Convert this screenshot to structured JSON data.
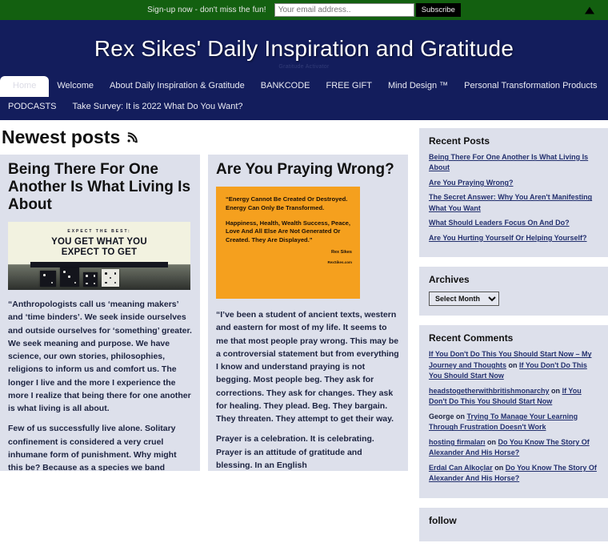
{
  "topbar": {
    "signup_text": "Sign-up now - don't miss the fun!",
    "email_placeholder": "Your email address..",
    "subscribe_label": "Subscribe",
    "scroll_top_icon": "triangle-up-icon",
    "bg_color": "#136010"
  },
  "header": {
    "title": "Rex Sikes' Daily Inspiration and Gratitude",
    "tagline": "Gratitude Activator",
    "bg_color": "#131d5c"
  },
  "nav": {
    "items": [
      {
        "label": "Home",
        "active": true
      },
      {
        "label": "Welcome",
        "active": false
      },
      {
        "label": "About Daily Inspiration & Gratitude",
        "active": false
      },
      {
        "label": "BANKCODE",
        "active": false
      },
      {
        "label": "FREE GIFT",
        "active": false
      },
      {
        "label": "Mind Design ™",
        "active": false
      },
      {
        "label": "Personal Transformation Products",
        "active": false
      }
    ],
    "items_row2": [
      {
        "label": "PODCASTS",
        "active": false
      },
      {
        "label": "Take Survey: It is 2022 What Do You Want?",
        "active": false
      }
    ]
  },
  "main": {
    "section_heading": "Newest posts",
    "rss_icon": "rss-feed-icon",
    "posts": [
      {
        "title": "Being There For One Another Is What Living Is About",
        "featured_image": {
          "type": "expect-the-best-dice-banner",
          "kicker": "EXPECT THE BEST:",
          "headline_line1": "YOU GET WHAT YOU",
          "headline_line2": "EXPECT TO GET"
        },
        "paragraphs": [
          "“Anthropologists call us ‘meaning makers’ and ‘time binders’. We seek inside ourselves and outside ourselves for ‘something’ greater. We seek meaning and purpose. We have science, our own stories, philosophies, religions to inform us and comfort us. The longer I live and the more I experience the more I realize that being there for one another is what living is all about.",
          "Few of us successfully live alone. Solitary confinement is considered a very cruel inhumane form of punishment. Why might this be? Because as a species we band together. From the earliest times"
        ]
      },
      {
        "title": "Are You Praying Wrong?",
        "featured_image": {
          "type": "orange-quote-card",
          "bg_color": "#f5a01e",
          "quote_block1": "“Energy Cannot Be Created Or Destroyed. Energy Can Only Be Transformed.",
          "quote_block2": "Happiness, Health, Wealth Success, Peace, Love And All Else Are Not Generated Or Created. They Are Displayed.”",
          "author": "Rex Sikes",
          "site": "RexSikes.com"
        },
        "paragraphs": [
          "“I’ve been a student of ancient texts, western and eastern for most of my life. It seems to me that most people pray wrong. This may be a controversial statement but from everything I know and understand praying is not begging. Most people beg. They ask for corrections. They ask for changes. They ask for healing. They plead. Beg. They bargain. They threaten. They attempt to get their way.",
          "Prayer is a celebration. It is celebrating. Prayer is an attitude of gratitude and blessing. In an English"
        ]
      }
    ]
  },
  "sidebar": {
    "recent_posts": {
      "title": "Recent Posts",
      "items": [
        "Being There For One Another Is What Living Is About",
        "Are You Praying Wrong?",
        "The Secret Answer: Why You Aren't Manifesting What You Want",
        "What Should Leaders Focus On And Do?",
        "Are You Hurting Yourself Or Helping Yourself?"
      ]
    },
    "archives": {
      "title": "Archives",
      "selected": "Select Month"
    },
    "recent_comments": {
      "title": "Recent Comments",
      "connector": "on",
      "items": [
        {
          "author": "If You Don't Do This You Should Start Now – My Journey and Thoughts",
          "author_is_link": true,
          "post": "If You Don't Do This You Should Start Now"
        },
        {
          "author": "headstogetherwithbritishmonarchy",
          "author_is_link": true,
          "post": "If You Don't Do This You Should Start Now"
        },
        {
          "author": "George",
          "author_is_link": false,
          "post": "Trying To Manage Your Learning Through Frustration Doesn't Work"
        },
        {
          "author": "hosting firmaları",
          "author_is_link": true,
          "post": "Do You Know The Story Of Alexander And His Horse?"
        },
        {
          "author": "Erdal Can Alkoçlar",
          "author_is_link": true,
          "post": "Do You Know The Story Of Alexander And His Horse?"
        }
      ]
    },
    "follow": {
      "title": "follow"
    }
  }
}
